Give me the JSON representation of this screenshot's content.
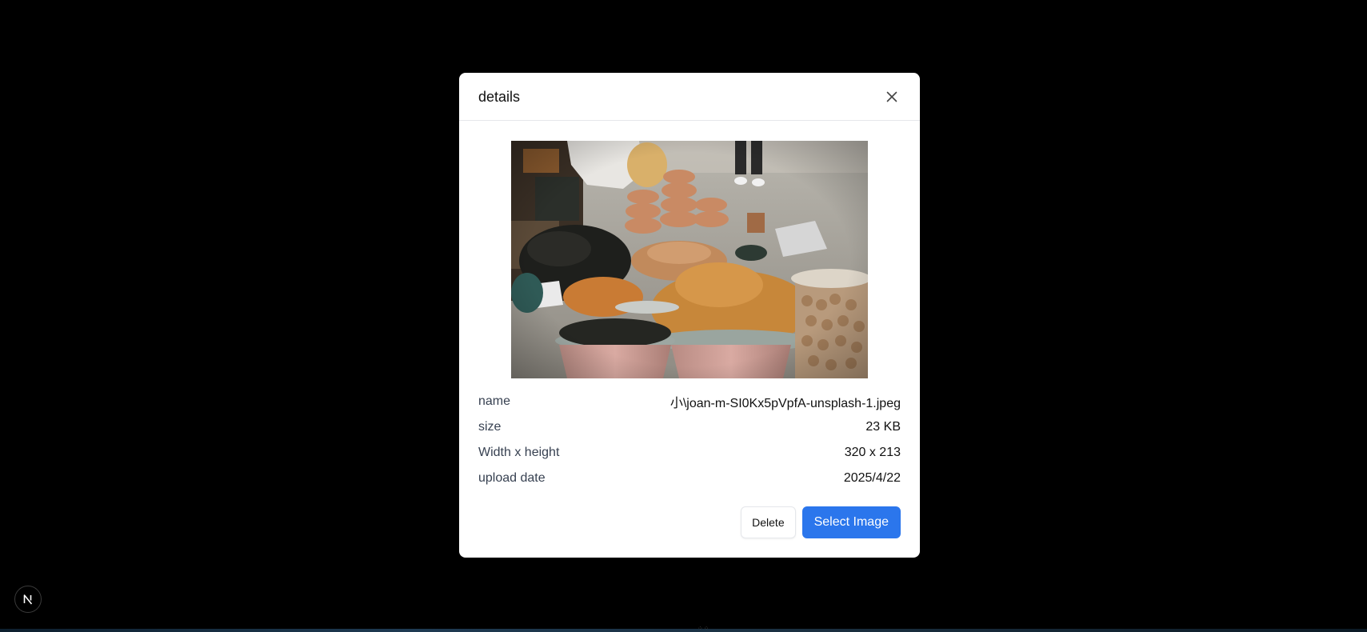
{
  "modal": {
    "title": "details",
    "image_alt": "joan-m-SI0Kx5pVpfA-unsplash-1.jpeg"
  },
  "details": [
    {
      "label": "name",
      "value": "小\\joan-m-SI0Kx5pVpfA-unsplash-1.jpeg"
    },
    {
      "label": "size",
      "value": "23 KB"
    },
    {
      "label": "Width x height",
      "value": "320 x 213"
    },
    {
      "label": "upload date",
      "value": "2025/4/22"
    }
  ],
  "actions": {
    "delete_label": "Delete",
    "select_label": "Select Image"
  },
  "icons": {
    "close": "close-icon",
    "dev_badge": "nextjs-logo-icon"
  },
  "colors": {
    "primary": "#2b76ec",
    "backdrop": "#000000",
    "surface": "#ffffff"
  }
}
